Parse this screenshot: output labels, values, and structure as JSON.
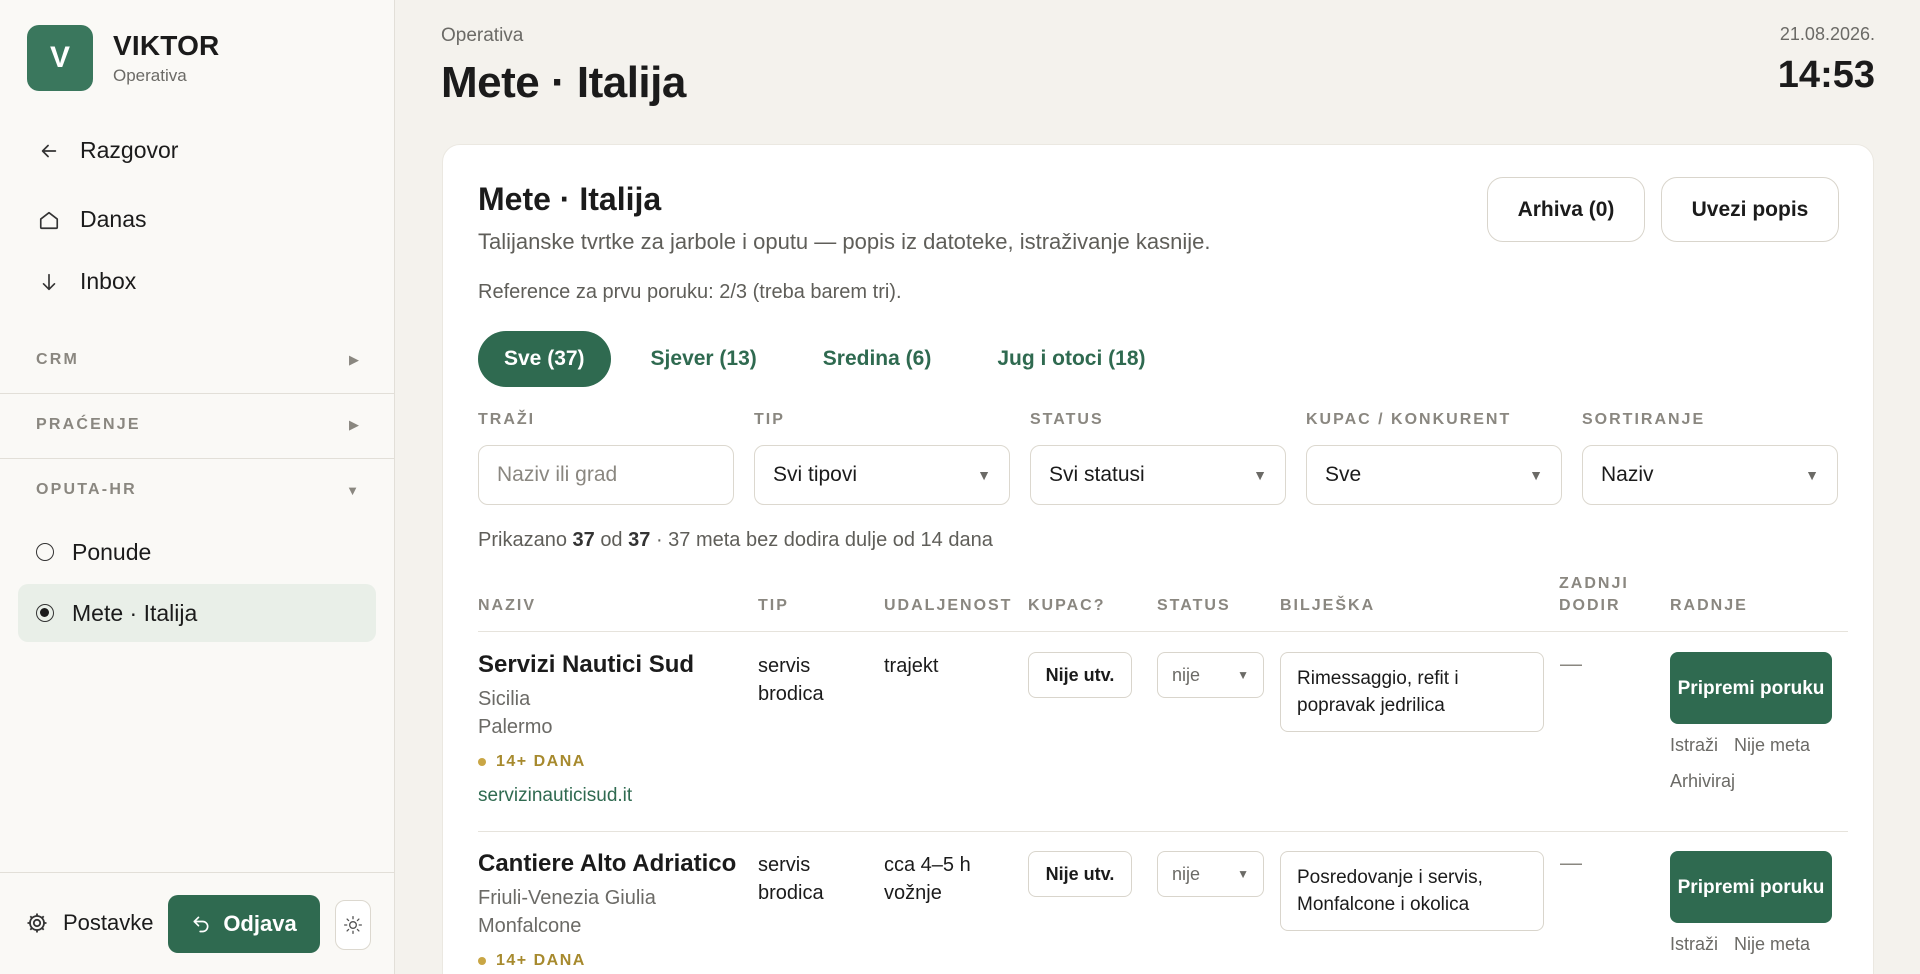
{
  "brand": {
    "initial": "V",
    "name": "VIKTOR",
    "subtitle": "Operativa"
  },
  "nav": [
    {
      "label": "Razgovor",
      "icon": "arrow-left-icon"
    },
    {
      "label": "Danas",
      "icon": "home-icon"
    },
    {
      "label": "Inbox",
      "icon": "arrow-down-icon"
    }
  ],
  "sections": {
    "crm": {
      "label": "CRM",
      "arrow": "▶"
    },
    "pracenje": {
      "label": "PRAĆENJE",
      "arrow": "▶"
    },
    "oputa": {
      "label": "OPUTA-HR",
      "arrow": "▼"
    }
  },
  "sub_items": [
    {
      "label": "Ponude",
      "selected": false
    },
    {
      "label": "Mete · Italija",
      "selected": true
    }
  ],
  "footer": {
    "settings_label": "Postavke",
    "logout_label": "Odjava"
  },
  "header": {
    "breadcrumb": "Operativa",
    "title": "Mete · Italija",
    "date": "21.08.2026.",
    "time": "14:53"
  },
  "card": {
    "title": "Mete · Italija",
    "description": "Talijanske tvrtke za jarbole i oputu — popis iz datoteke, istraživanje kasnije.",
    "reference": "Reference za prvu poruku: 2/3 (treba barem tri).",
    "archive_button": "Arhiva (0)",
    "import_button": "Uvezi popis"
  },
  "tabs": [
    {
      "label": "Sve (37)",
      "active": true
    },
    {
      "label": "Sjever (13)",
      "active": false
    },
    {
      "label": "Sredina (6)",
      "active": false
    },
    {
      "label": "Jug i otoci (18)",
      "active": false
    }
  ],
  "filters": {
    "search": {
      "label": "TRAŽI",
      "placeholder": "Naziv ili grad"
    },
    "type": {
      "label": "TIP",
      "value": "Svi tipovi"
    },
    "status": {
      "label": "STATUS",
      "value": "Svi statusi"
    },
    "buyer": {
      "label": "KUPAC / KONKURENT",
      "value": "Sve"
    },
    "sort": {
      "label": "SORTIRANJE",
      "value": "Naziv"
    }
  },
  "count": {
    "prefix": "Prikazano",
    "shown": "37",
    "middle": "od",
    "total": "37",
    "suffix": "· 37 meta bez dodira dulje od 14 dana"
  },
  "table": {
    "headers": {
      "naziv": "NAZIV",
      "tip": "TIP",
      "udaljenost": "UDALJENOST",
      "kupac": "KUPAC?",
      "status": "STATUS",
      "biljeska": "BILJEŠKA",
      "zadnji_1": "ZADNJI",
      "zadnji_2": "DODIR",
      "radnje": "RADNJE"
    },
    "rows": [
      {
        "name": "Servizi Nautici Sud",
        "region": "Sicilia",
        "city": "Palermo",
        "badge": "14+ DANA",
        "website": "servizinauticisud.it",
        "type_1": "servis",
        "type_2": "brodica",
        "distance_1": "trajekt",
        "distance_2": "",
        "buyer": "Nije utv.",
        "status": "nije",
        "note": "Rimessaggio, refit i popravak jedrilica",
        "last_contact": "—",
        "primary_action": "Pripremi poruku",
        "research": "Istraži",
        "not_target": "Nije meta",
        "archive": "Arhiviraj"
      },
      {
        "name": "Cantiere Alto Adriatico",
        "region": "Friuli-Venezia Giulia",
        "city": "Monfalcone",
        "badge": "14+ DANA",
        "type_1": "servis",
        "type_2": "brodica",
        "distance_1": "cca 4–5 h",
        "distance_2": "vožnje",
        "buyer": "Nije utv.",
        "status": "nije",
        "note": "Posredovanje i servis, Monfalcone i okolica",
        "last_contact": "—",
        "primary_action": "Pripremi poruku",
        "research": "Istraži",
        "not_target": "Nije meta"
      }
    ]
  }
}
